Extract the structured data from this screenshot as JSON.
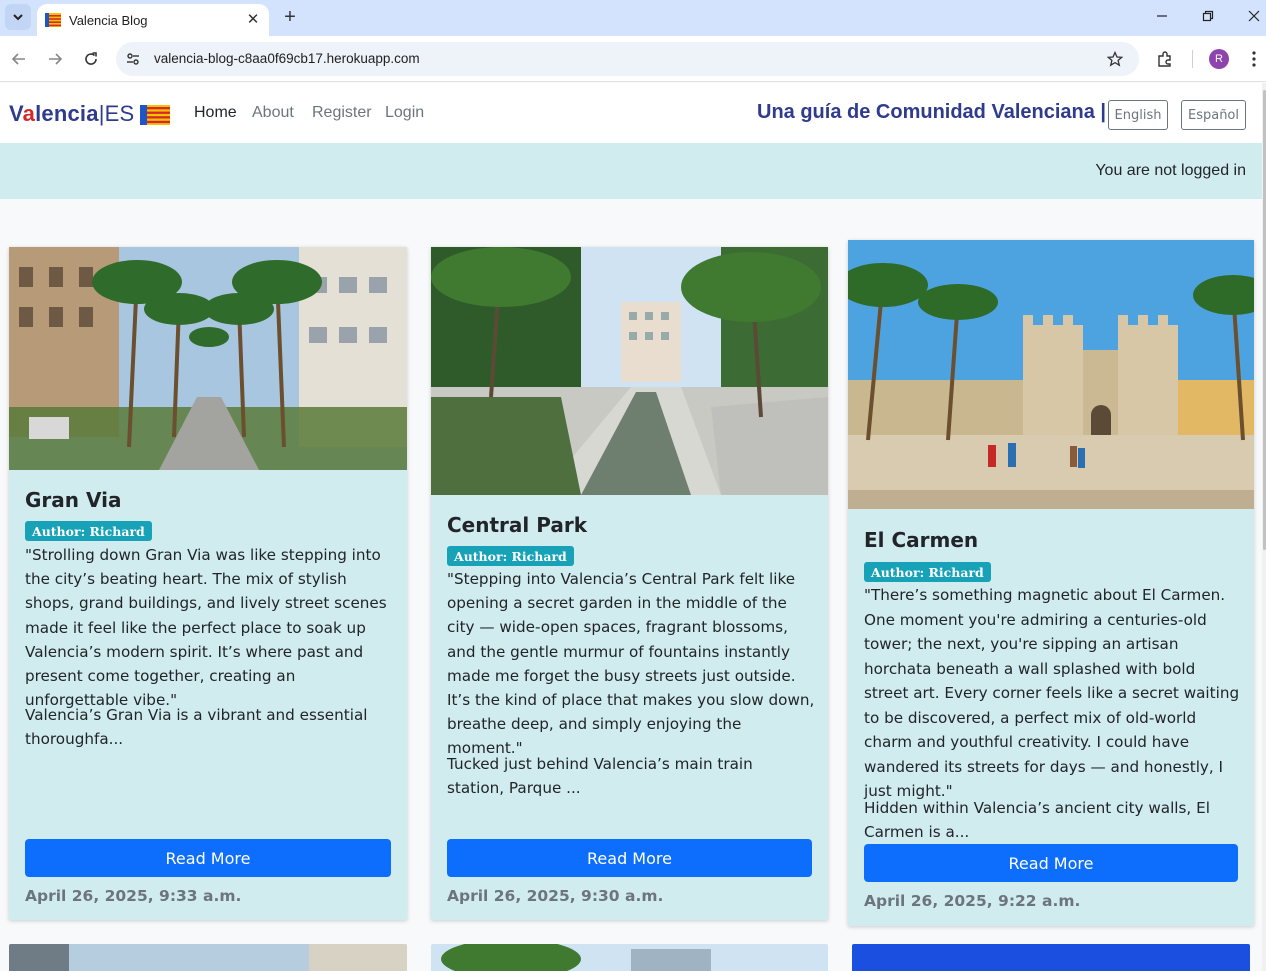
{
  "browser": {
    "tab_title": "Valencia Blog",
    "url": "valencia-blog-c8aa0f69cb17.herokuapp.com",
    "profile_initial": "R"
  },
  "site": {
    "brand_name_v": "V",
    "brand_name_a": "a",
    "brand_name_rest": "lencia",
    "brand_pipe": "|",
    "brand_suffix": "ES",
    "nav": {
      "home": "Home",
      "about": "About",
      "register": "Register",
      "login": "Login"
    },
    "tagline": "Una guía de Comunidad Valenciana |",
    "lang_english": "English",
    "lang_spanish": "Español",
    "status": "You are not logged in",
    "colors": {
      "brand": "#2f3b8c",
      "accent_red": "#d62828",
      "card_bg": "#d1ecef",
      "button": "#0d6efd",
      "badge": "#17a2b8"
    }
  },
  "posts": [
    {
      "title": "Gran Via",
      "author": "Author: Richard",
      "quote": "\"Strolling down Gran Via was like stepping into the city’s beating heart. The mix of stylish shops, grand buildings, and lively street scenes made it feel like the perfect place to soak up Valencia’s modern spirit. It’s where past and present come together, creating an unforgettable vibe.\"",
      "excerpt": "Valencia’s Gran Via is a vibrant and essential thoroughfa...",
      "button": "Read More",
      "date": "April 26, 2025, 9:33 a.m."
    },
    {
      "title": "Central Park",
      "author": "Author: Richard",
      "quote": "\"Stepping into Valencia’s Central Park felt like opening a secret garden in the middle of the city — wide-open spaces, fragrant blossoms, and the gentle murmur of fountains instantly made me forget the busy streets just outside. It’s the kind of place that makes you slow down, breathe deep, and simply enjoying the moment.\"",
      "excerpt": "Tucked just behind Valencia’s main train station, Parque ...",
      "button": "Read More",
      "date": "April 26, 2025, 9:30 a.m."
    },
    {
      "title": "El Carmen",
      "author": "Author: Richard",
      "quote": "\"There’s something magnetic about El Carmen. One moment you're admiring a centuries-old tower; the next, you're sipping an artisan horchata beneath a wall splashed with bold street art. Every corner feels like a secret waiting to be discovered, a perfect mix of old-world charm and youthful creativity. I could have wandered its streets for days — and honestly, I just might.\"",
      "excerpt": "Hidden within Valencia’s ancient city walls, El Carmen is a...",
      "button": "Read More",
      "date": "April 26, 2025, 9:22 a.m."
    }
  ]
}
